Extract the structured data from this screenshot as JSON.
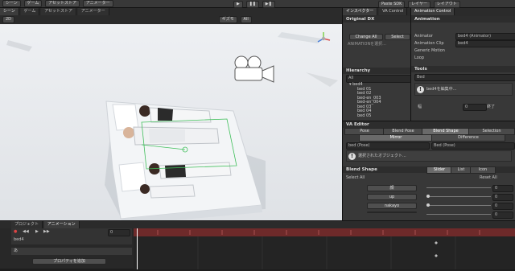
{
  "menubar": {
    "left_items": [
      "シーン",
      "ゲーム",
      "アセットストア",
      "アニメーター"
    ],
    "center": {
      "play": "▶",
      "pause": "❚❚",
      "step": "▶❚"
    },
    "right_items": [
      "Paste SDK",
      "レイヤー",
      "レイアウト"
    ]
  },
  "scene_toolbar": {
    "tabs": [
      "シーン",
      "ゲーム",
      "アセットストア",
      "アニメーター"
    ],
    "shading": "2D",
    "gizmos": "ギズモ",
    "search": "All"
  },
  "inspector_tabs": [
    "インスペクター",
    "VA Control",
    "Animation Control"
  ],
  "original_dl": {
    "header": "Original DX",
    "change_all": "Change All",
    "select": "Select",
    "note": "ANIMATIONを選択..."
  },
  "animation": {
    "header": "Animation",
    "animator_label": "Animator",
    "animator_value": "bed4 (Animator)",
    "clip_label": "Animation Clip",
    "clip_value": "bed4",
    "generic_label": "Generic Motion",
    "loop_label": "Loop"
  },
  "hierarchy": {
    "header": "Hierarchy",
    "search": "All",
    "items": [
      "bed4",
      "bed 01",
      "bed 02",
      "bed-en_003",
      "bed-en_004",
      "bed 03",
      "bed 04",
      "bed 05"
    ]
  },
  "tools": {
    "header": "Tools",
    "dropdown": "Bed",
    "info": "bed4を編集中...",
    "num_label": "幅",
    "num_value": "0",
    "num_unit": "終了"
  },
  "va_editor": {
    "header": "VA Editor",
    "tabs": [
      "Pose",
      "Blend Pose",
      "Blend Shape",
      "Selection"
    ],
    "subtabs": [
      "Mirror",
      "Difference"
    ],
    "left_field": "bed (Pose)",
    "right_field": "Bed (Pose)",
    "info": "選択されたオブジェクト...",
    "blend_shape_header": "Blend Shape",
    "bs_modes": [
      "Slider",
      "List",
      "Icon"
    ],
    "select_all": "Select All",
    "reset_all": "Reset All",
    "rows": [
      {
        "label": "顔",
        "value": 0
      },
      {
        "label": "up",
        "value": 0
      },
      {
        "label": "nakayo",
        "value": 0
      },
      {
        "label": "",
        "value": 0
      }
    ]
  },
  "timeline": {
    "tabs": [
      "プロジェクト",
      "アニメーション"
    ],
    "clip": "bed4",
    "frame": "0",
    "track_label": "あ",
    "add_property": "プロパティを追加"
  },
  "colors": {
    "keyframe_bar": "#6e2a2a",
    "playhead": "#ffffff",
    "scene_bg": "#e9ecef"
  }
}
